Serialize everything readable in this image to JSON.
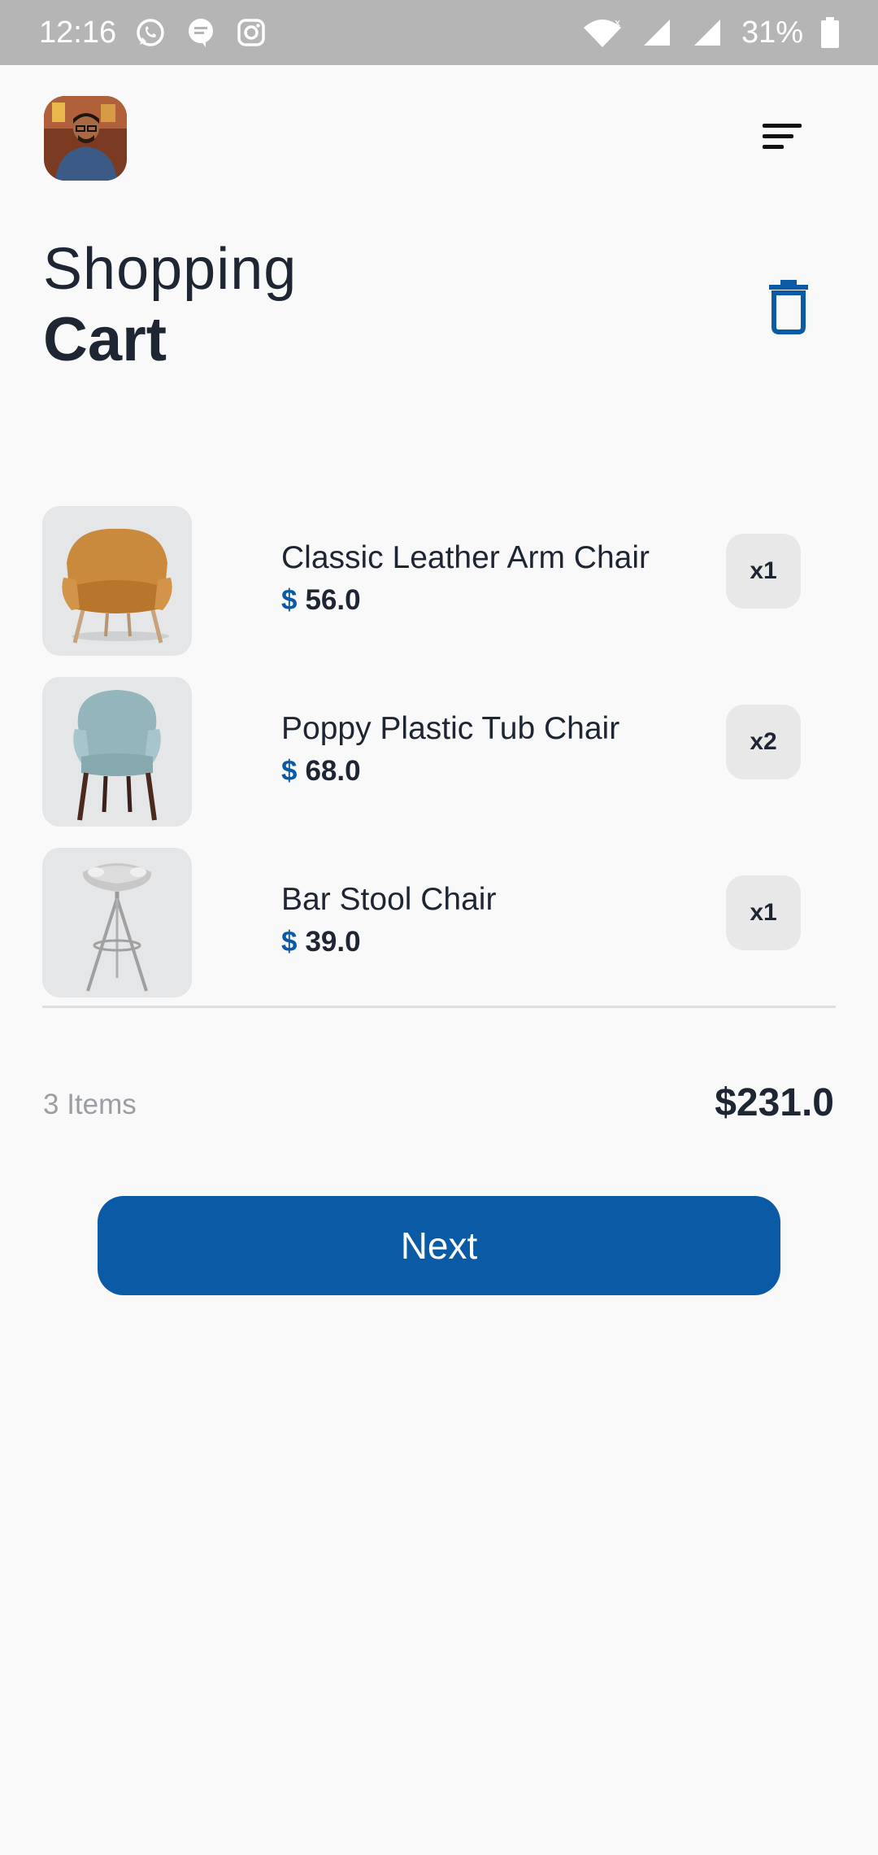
{
  "status_bar": {
    "time": "12:16",
    "battery": "31%",
    "left_icons": [
      "whatsapp-icon",
      "message-icon",
      "instagram-icon"
    ],
    "right_icons": [
      "wifi-icon",
      "signal-icon",
      "signal-icon",
      "battery-icon"
    ]
  },
  "header": {
    "avatar_icon": "profile-photo",
    "menu_icon": "sort-menu-icon"
  },
  "page": {
    "title_line1": "Shopping",
    "title_line2": "Cart",
    "delete_icon": "trash-icon"
  },
  "cart": {
    "items": [
      {
        "name": "Classic Leather Arm Chair",
        "currency": "$",
        "price": "56.0",
        "quantity": "x1",
        "image": "armchair"
      },
      {
        "name": "Poppy Plastic Tub Chair",
        "currency": "$",
        "price": "68.0",
        "quantity": "x2",
        "image": "tub-chair"
      },
      {
        "name": "Bar Stool Chair",
        "currency": "$",
        "price": "39.0",
        "quantity": "x1",
        "image": "bar-stool"
      }
    ]
  },
  "summary": {
    "items_count": "3 Items",
    "total": "$231.0"
  },
  "actions": {
    "next_label": "Next"
  },
  "colors": {
    "accent": "#0b5aa6",
    "text_dark": "#1e2533",
    "muted": "#9b9ea3",
    "status_bar": "#b5b5b5"
  }
}
